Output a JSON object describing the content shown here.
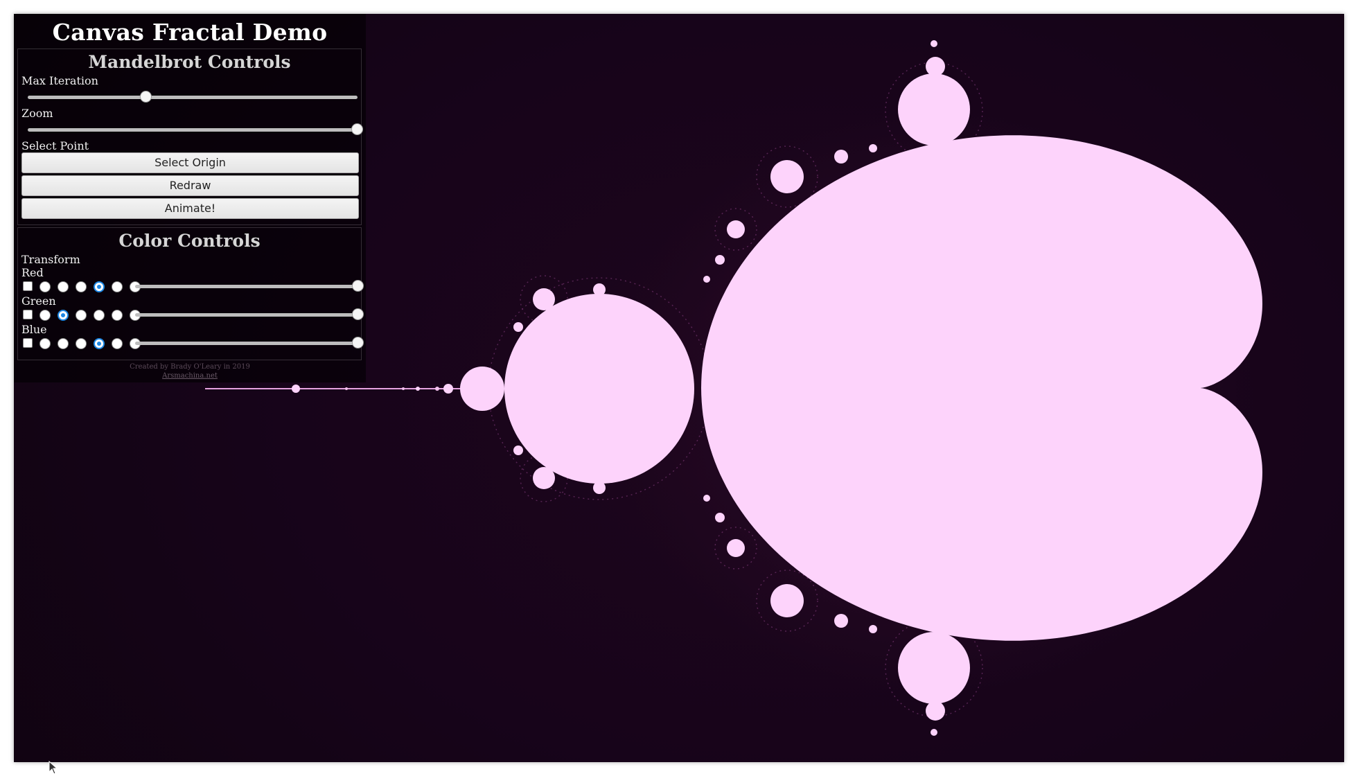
{
  "app": {
    "title": "Canvas Fractal Demo"
  },
  "mandelbrot_controls": {
    "heading": "Mandelbrot Controls",
    "max_iteration": {
      "label": "Max Iteration",
      "value_fraction": 0.36
    },
    "zoom": {
      "label": "Zoom",
      "value_fraction": 1.0
    },
    "select_point_label": "Select Point",
    "buttons": {
      "select_origin": "Select Origin",
      "redraw": "Redraw",
      "animate": "Animate!"
    }
  },
  "color_controls": {
    "heading": "Color Controls",
    "transform_label": "Transform",
    "channels": [
      {
        "name": "Red",
        "checked": false,
        "selected_radio": 3,
        "radio_count": 6,
        "slider_fraction": 1.0
      },
      {
        "name": "Green",
        "checked": false,
        "selected_radio": 1,
        "radio_count": 6,
        "slider_fraction": 1.0
      },
      {
        "name": "Blue",
        "checked": false,
        "selected_radio": 3,
        "radio_count": 6,
        "slider_fraction": 1.0
      }
    ]
  },
  "credits": {
    "line": "Created by Brady O'Leary in 2019",
    "link": "Arsmachina.net"
  },
  "colors": {
    "set_fill": "#fdd3fb",
    "filament": "#9a4d93",
    "background_dark": "#12040f",
    "radio_selected": "#1e88e5"
  },
  "icons": {
    "cursor": "mouse-pointer-icon"
  }
}
